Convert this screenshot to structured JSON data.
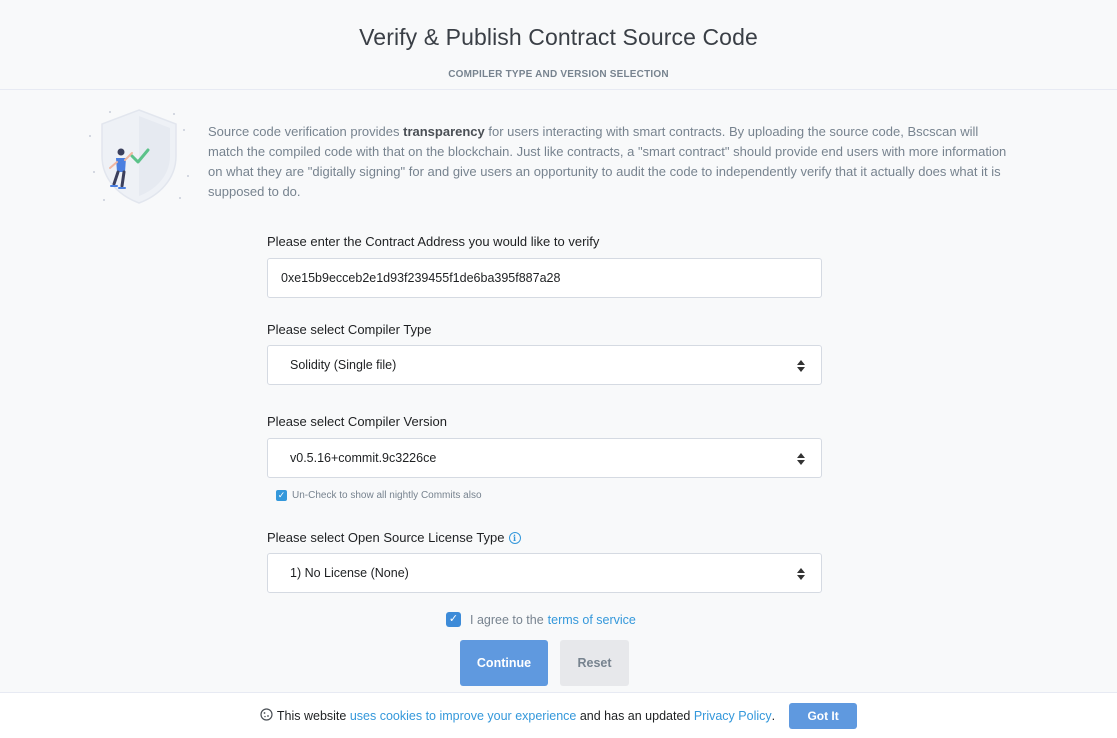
{
  "header": {
    "title": "Verify & Publish Contract Source Code",
    "subtitle": "COMPILER TYPE AND VERSION SELECTION"
  },
  "intro": {
    "illustration_icon": "shield-person-check-icon",
    "text_before": "Source code verification provides ",
    "text_bold": "transparency",
    "text_after": " for users interacting with smart contracts. By uploading the source code, Bscscan will match the compiled code with that on the blockchain. Just like contracts, a \"smart contract\" should provide end users with more information on what they are \"digitally signing\" for and give users an opportunity to audit the code to independently verify that it actually does what it is supposed to do."
  },
  "form": {
    "address_label": "Please enter the Contract Address you would like to verify",
    "address_value": "0xe15b9ecceb2e1d93f239455f1de6ba395f887a28",
    "compiler_type_label": "Please select Compiler Type",
    "compiler_type_value": "Solidity (Single file)",
    "compiler_version_label": "Please select Compiler Version",
    "compiler_version_value": "v0.5.16+commit.9c3226ce",
    "nightly_note": "Un-Check to show all nightly Commits also",
    "license_label": "Please select Open Source License Type",
    "license_value": "1) No License (None)",
    "agree_prefix": "I agree to the ",
    "terms_link": "terms of service",
    "continue_label": "Continue",
    "reset_label": "Reset"
  },
  "cookie": {
    "prefix": "This website ",
    "link1": "uses cookies to improve your experience",
    "middle": " and has an updated ",
    "link2": "Privacy Policy",
    "suffix": ".",
    "button": "Got It"
  },
  "colors": {
    "accent": "#3498db",
    "button_primary": "#5f99df",
    "background": "#f8f9fa"
  }
}
